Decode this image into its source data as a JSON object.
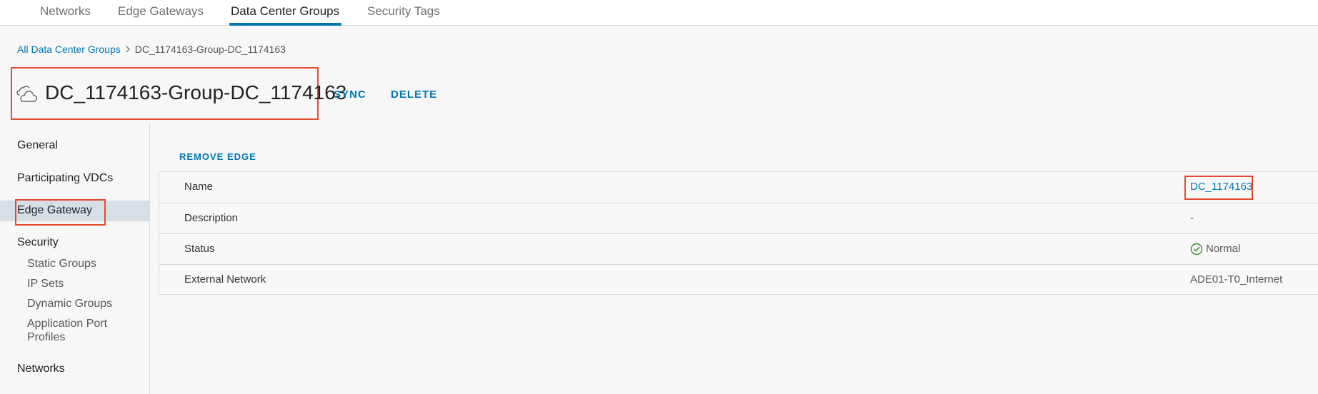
{
  "tabs": [
    {
      "label": "Networks",
      "active": false
    },
    {
      "label": "Edge Gateways",
      "active": false
    },
    {
      "label": "Data Center Groups",
      "active": true
    },
    {
      "label": "Security Tags",
      "active": false
    }
  ],
  "breadcrumb": {
    "parent": "All Data Center Groups",
    "current": "DC_1174163-Group-DC_1174163"
  },
  "header": {
    "icon": "data-center-group-icon",
    "title": "DC_1174163-Group-DC_1174163",
    "sync_label": "SYNC",
    "delete_label": "DELETE"
  },
  "sidebar": {
    "items": [
      {
        "label": "General"
      },
      {
        "label": "Participating VDCs"
      },
      {
        "label": "Edge Gateway",
        "active": true
      },
      {
        "label": "Security"
      },
      {
        "label": "Static Groups"
      },
      {
        "label": "IP Sets"
      },
      {
        "label": "Dynamic Groups"
      },
      {
        "label": "Application Port Profiles"
      },
      {
        "label": "Networks"
      }
    ]
  },
  "content": {
    "remove_edge_label": "REMOVE EDGE",
    "details": [
      {
        "label": "Name",
        "value": "DC_1174163"
      },
      {
        "label": "Description",
        "value": "-"
      },
      {
        "label": "Status",
        "value": "Normal",
        "icon": "check-circle-icon"
      },
      {
        "label": "External Network",
        "value": "ADE01-T0_Internet"
      }
    ]
  },
  "colors": {
    "accent": "#0076b3",
    "highlight_border": "#e64a2e",
    "status_ok": "#3c8b2c",
    "nav_active_bg": "#d6dfe6"
  }
}
